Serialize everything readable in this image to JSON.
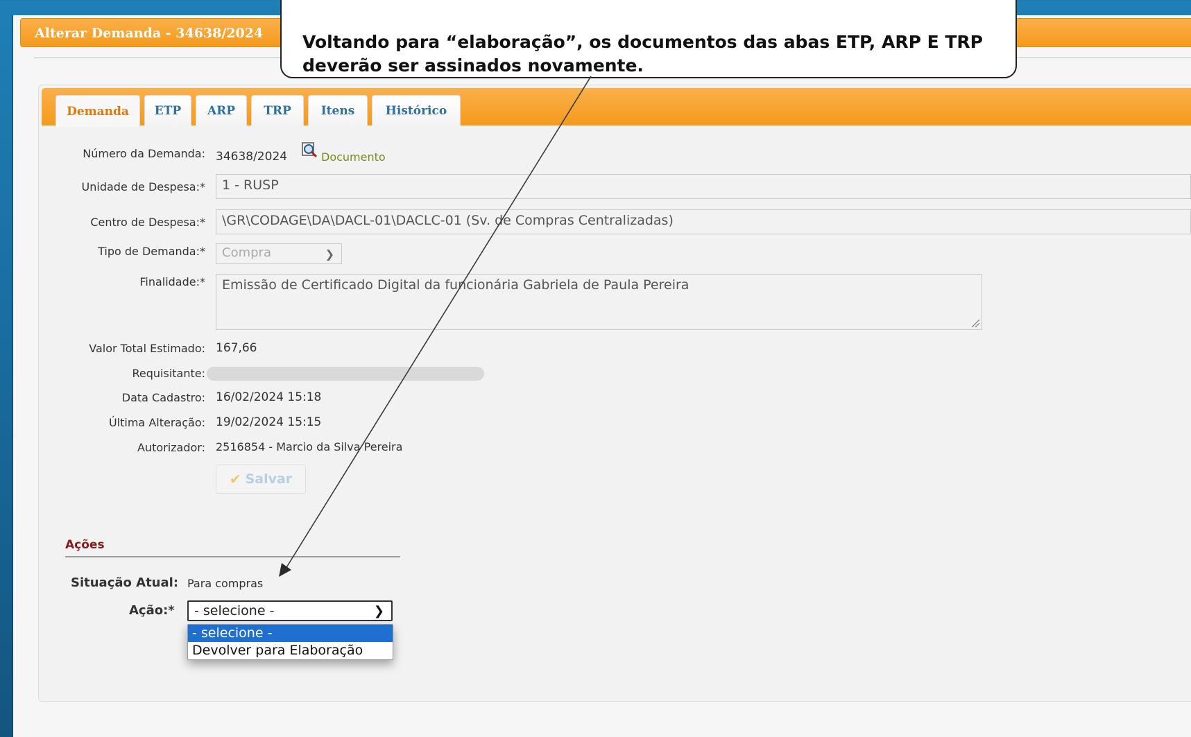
{
  "window": {
    "title": "Alterar Demanda - 34638/2024"
  },
  "tabs": [
    {
      "label": "Demanda",
      "active": true
    },
    {
      "label": "ETP",
      "active": false
    },
    {
      "label": "ARP",
      "active": false
    },
    {
      "label": "TRP",
      "active": false
    },
    {
      "label": "Itens",
      "active": false
    },
    {
      "label": "Histórico",
      "active": false
    }
  ],
  "form": {
    "numero_label": "Número da Demanda:",
    "numero_value": "34638/2024",
    "documento_link": "Documento",
    "unidade_label": "Unidade de Despesa:*",
    "unidade_value": "1 - RUSP",
    "centro_label": "Centro de Despesa:*",
    "centro_value": "\\GR\\CODAGE\\DA\\DACL-01\\DACLC-01 (Sv. de Compras Centralizadas)",
    "tipo_label": "Tipo de Demanda:*",
    "tipo_value": "Compra",
    "finalidade_label": "Finalidade:*",
    "finalidade_value": "Emissão de Certificado Digital da funcionária Gabriela de Paula Pereira",
    "valor_label": "Valor Total Estimado:",
    "valor_value": "167,66",
    "requisitante_label": "Requisitante:",
    "data_cadastro_label": "Data Cadastro:",
    "data_cadastro_value": "16/02/2024 15:18",
    "ultima_alteracao_label": "Última Alteração:",
    "ultima_alteracao_value": "19/02/2024 15:15",
    "autorizador_label": "Autorizador:",
    "autorizador_value": "2516854 - Marcio da Silva Pereira",
    "save_label": "Salvar"
  },
  "acoes": {
    "title": "Ações",
    "situacao_label": "Situação Atual:",
    "situacao_value": "Para compras",
    "acao_label": "Ação:*",
    "acao_selected": "- selecione -",
    "options": [
      "- selecione -",
      "Devolver para Elaboração"
    ]
  },
  "callout": {
    "line1": "Voltando para “elaboração”, os documentos das abas ETP, ARP E TRP",
    "line2": "deverão ser assinados novamente."
  },
  "colors": {
    "accent_orange": "#f49a1c",
    "tab_text_blue": "#2f6f9f",
    "active_tab_text": "#e07810",
    "acoes_title": "#8b1a1a",
    "dropdown_highlight": "#1f6fd0"
  }
}
